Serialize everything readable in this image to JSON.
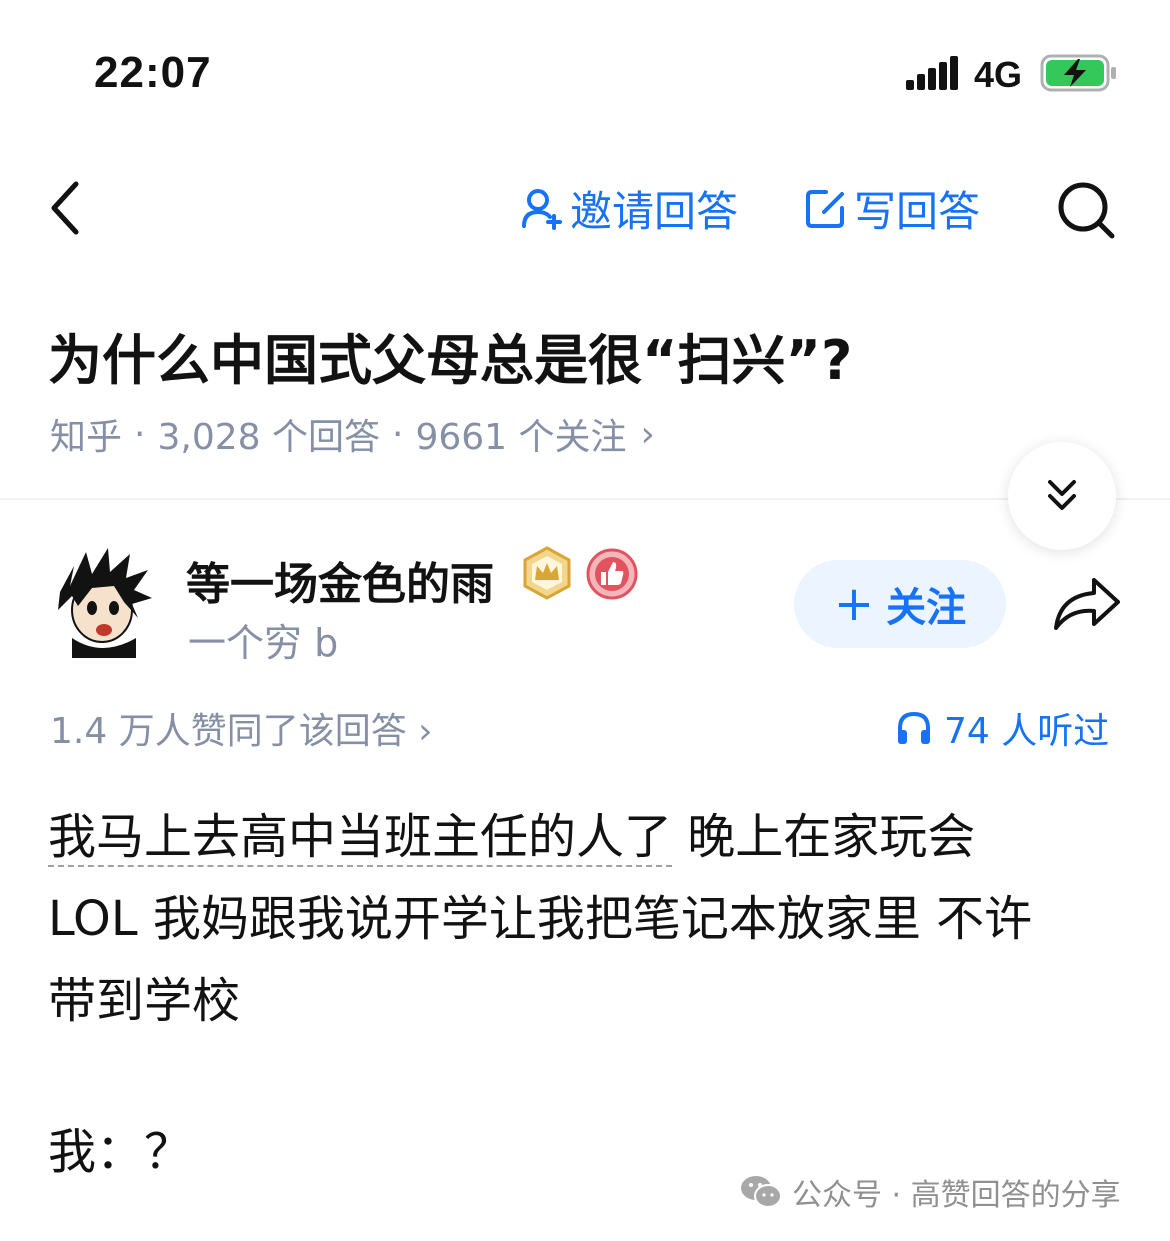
{
  "status_bar": {
    "time": "22:07",
    "network": "4G",
    "icons": [
      "signal-icon",
      "battery-charging-icon"
    ],
    "battery_color": "#34c759"
  },
  "nav": {
    "back_icon": "chevron-left-icon",
    "invite_label": "邀请回答",
    "write_label": "写回答",
    "search_icon": "search-icon",
    "accent_color": "#1772f6"
  },
  "question": {
    "title": "为什么中国式父母总是很“扫兴”?",
    "source": "知乎",
    "separator": "·",
    "answers": "3,028 个回答",
    "followers": "9661 个关注",
    "chevron": "›"
  },
  "author": {
    "name": "等一场金色的雨",
    "bio": "一个穷 b",
    "badges": [
      "crown-badge-icon",
      "thumbs-up-badge-icon"
    ],
    "follow_plus": "+",
    "follow_label": "关注",
    "share_icon": "share-icon"
  },
  "stats": {
    "votes": "1.4 万人赞同了该回答 ›",
    "listened": "74 人听过",
    "listen_icon": "headphones-icon"
  },
  "answer": {
    "line1_underlined": "我马上去高中当班主任的人了",
    "line1_rest": " 晚上在家玩会",
    "line2": "LOL 我妈跟我说开学让我把笔记本放家里 不许",
    "line3": "带到学校",
    "last": "我：？"
  },
  "watermark": {
    "text": "公众号 · 高赞回答的分享",
    "icon": "wechat-icon"
  }
}
